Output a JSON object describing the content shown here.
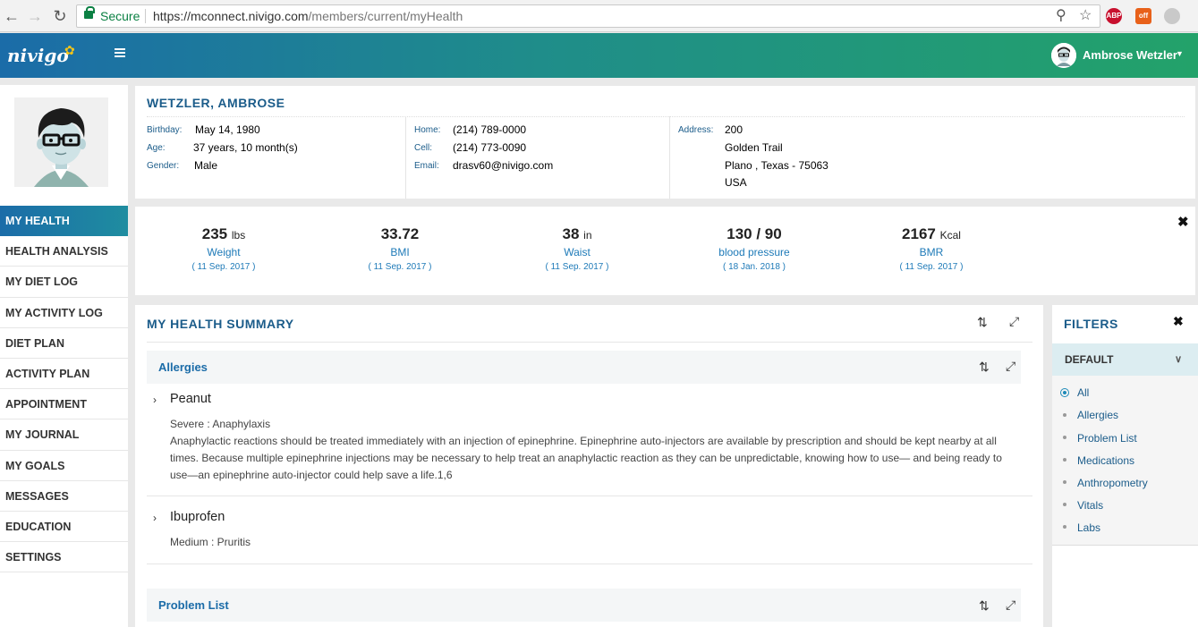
{
  "browser": {
    "secure_label": "Secure",
    "url_host": "https://mconnect.nivigo.com",
    "url_path": "/members/current/myHealth",
    "ext_abp": "ABP",
    "ext_off": "off"
  },
  "app": {
    "logo_text": "nivigo",
    "user_name": "Ambrose Wetzler"
  },
  "sidebar": {
    "items": [
      {
        "label": "MY HEALTH",
        "active": true
      },
      {
        "label": "HEALTH ANALYSIS"
      },
      {
        "label": "MY DIET LOG"
      },
      {
        "label": "MY ACTIVITY LOG"
      },
      {
        "label": "DIET PLAN"
      },
      {
        "label": "ACTIVITY PLAN"
      },
      {
        "label": "APPOINTMENT"
      },
      {
        "label": "MY JOURNAL"
      },
      {
        "label": "MY GOALS"
      },
      {
        "label": "MESSAGES"
      },
      {
        "label": "EDUCATION"
      },
      {
        "label": "SETTINGS"
      }
    ]
  },
  "profile": {
    "name": "WETZLER, AMBROSE",
    "birthday_label": "Birthday:",
    "birthday": "May 14, 1980",
    "age_label": "Age:",
    "age": "37 years, 10 month(s)",
    "gender_label": "Gender:",
    "gender": "Male",
    "home_label": "Home:",
    "home": "(214) 789-0000",
    "cell_label": "Cell:",
    "cell": "(214) 773-0090",
    "email_label": "Email:",
    "email": "drasv60@nivigo.com",
    "address_label": "Address:",
    "address_1": "200",
    "address_2": "Golden Trail",
    "address_3": "Plano , Texas - 75063",
    "address_4": "USA"
  },
  "stats": [
    {
      "value": "235",
      "unit": "lbs",
      "label": "Weight",
      "date": "( 11 Sep. 2017 )"
    },
    {
      "value": "33.72",
      "unit": "",
      "label": "BMI",
      "date": "( 11 Sep. 2017 )"
    },
    {
      "value": "38",
      "unit": "in",
      "label": "Waist",
      "date": "( 11 Sep. 2017 )"
    },
    {
      "value": "130 / 90",
      "unit": "",
      "label": "blood pressure",
      "date": "( 18 Jan. 2018 )"
    },
    {
      "value": "2167",
      "unit": "Kcal",
      "label": "BMR",
      "date": "( 11 Sep. 2017 )"
    }
  ],
  "summary": {
    "title": "MY HEALTH SUMMARY",
    "allergies_title": "Allergies",
    "peanut_title": "Peanut",
    "peanut_severity": "Severe : Anaphylaxis",
    "peanut_note_1": "Anaphylactic reactions should be treated immediately with an injection of epinephrine. Epinephrine auto-injectors are available by prescription and should be kept nearby at all",
    "peanut_note_2": "times. Because multiple epinephrine injections may be necessary to help treat an anaphylactic reaction as they can be unpredictable, knowing how to use— and being ready to",
    "peanut_note_3": "use—an epinephrine auto-injector could help save a life.1,6",
    "ibuprofen_title": "Ibuprofen",
    "ibuprofen_severity": "Medium : Pruritis",
    "problem_title": "Problem List"
  },
  "filters": {
    "title": "FILTERS",
    "default_label": "DEFAULT",
    "options": [
      "All",
      "Allergies",
      "Problem List",
      "Medications",
      "Anthropometry",
      "Vitals",
      "Labs"
    ],
    "selected": "All"
  }
}
